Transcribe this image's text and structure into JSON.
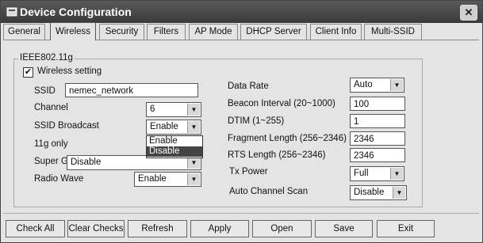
{
  "window": {
    "title": "Device Configuration",
    "close_glyph": "✕"
  },
  "tabs": [
    "General",
    "Wireless",
    "Security",
    "Filters",
    "AP Mode",
    "DHCP Server",
    "Client Info",
    "Multi-SSID"
  ],
  "active_tab": "Wireless",
  "group_title": "IEEE802.11g",
  "wireless_setting": {
    "label": "Wireless setting",
    "checked": true,
    "mark": "✔"
  },
  "left": {
    "ssid_label": "SSID",
    "ssid_value": "nemec_network",
    "channel_label": "Channel",
    "channel_value": "6",
    "ssid_broadcast_label": "SSID Broadcast",
    "ssid_broadcast_value": "Enable",
    "dropdown_options": [
      "Enable",
      "Disable"
    ],
    "g11only_label": "11g only",
    "superg_label": "Super G",
    "superg_value": "Disable",
    "radio_wave_label": "Radio Wave",
    "radio_wave_value": "Enable"
  },
  "right": {
    "data_rate_label": "Data Rate",
    "data_rate_value": "Auto",
    "beacon_label": "Beacon Interval (20~1000)",
    "beacon_value": "100",
    "dtim_label": "DTIM (1~255)",
    "dtim_value": "1",
    "frag_label": "Fragment Length (256~2346)",
    "frag_value": "2346",
    "rts_label": "RTS Length (256~2346)",
    "rts_value": "2346",
    "txpower_label": "Tx Power",
    "txpower_value": "Full",
    "autochan_label": "Auto Channel Scan",
    "autochan_value": "Disable"
  },
  "buttons": [
    "Check All",
    "Clear Checks",
    "Refresh",
    "Apply",
    "Open",
    "Save",
    "Exit"
  ],
  "arrow_glyph": "▼"
}
